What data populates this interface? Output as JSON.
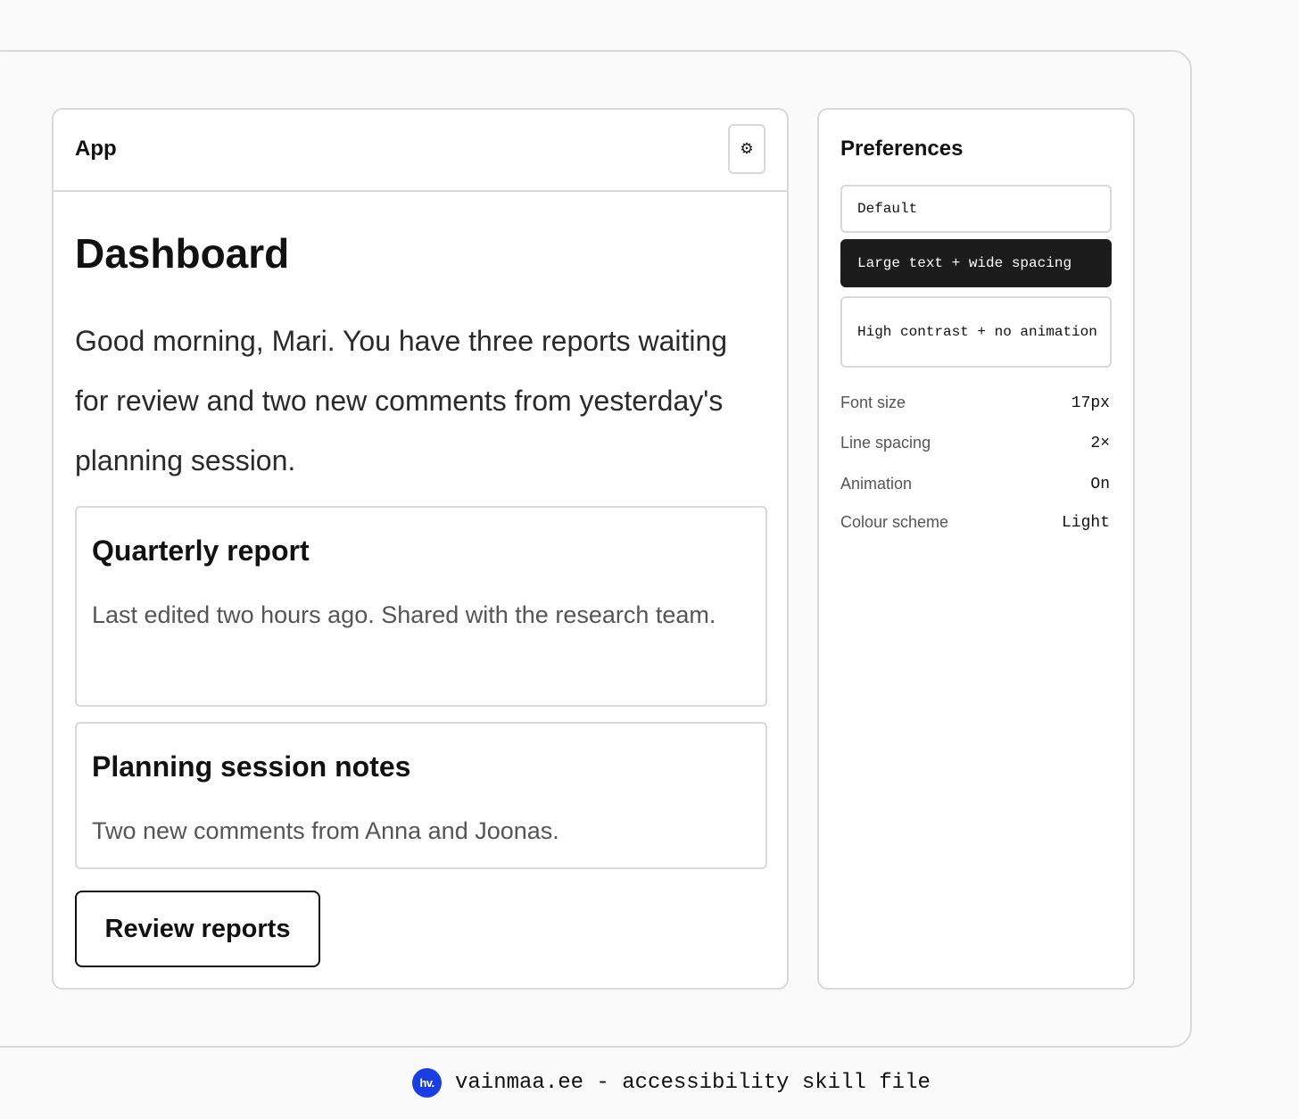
{
  "app": {
    "title": "App",
    "settings_icon": "⚙"
  },
  "dashboard": {
    "title": "Dashboard",
    "greeting": "Good morning, Mari. You have three reports waiting for review and two new comments from yesterday's planning session.",
    "cards": [
      {
        "title": "Quarterly report",
        "description": "Last edited two hours ago. Shared with the research team."
      },
      {
        "title": "Planning session notes",
        "description": "Two new comments from Anna and Joonas."
      }
    ],
    "review_button_label": "Review reports"
  },
  "preferences": {
    "title": "Preferences",
    "presets": [
      {
        "label": "Default",
        "selected": false
      },
      {
        "label": "Large text + wide spacing",
        "selected": true
      },
      {
        "label": "High contrast + no animation",
        "selected": false
      }
    ],
    "settings": [
      {
        "label": "Font size",
        "value": "17px"
      },
      {
        "label": "Line spacing",
        "value": "2×"
      },
      {
        "label": "Animation",
        "value": "On"
      },
      {
        "label": "Colour scheme",
        "value": "Light"
      }
    ]
  },
  "footer": {
    "logo_text": "hv.",
    "text": "vainmaa.ee - accessibility skill file"
  },
  "colors": {
    "accent": "#1a3fe0",
    "selected_preset_bg": "#1c1c1c",
    "border": "#d9d9d9"
  }
}
